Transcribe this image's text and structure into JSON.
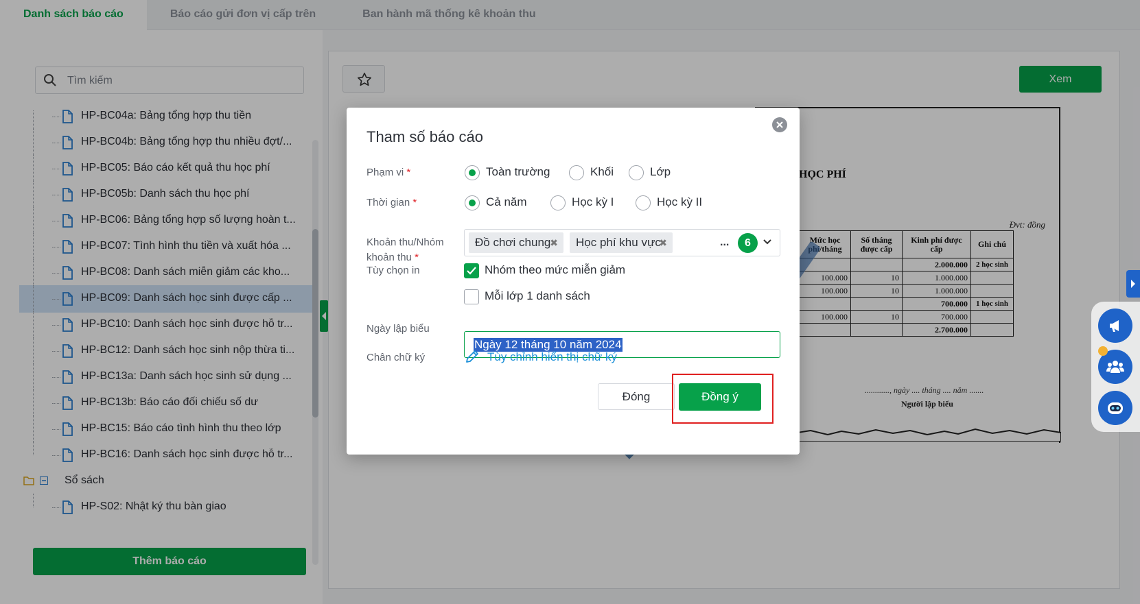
{
  "tabs": [
    {
      "label": "Danh sách báo cáo",
      "active": true
    },
    {
      "label": "Báo cáo gửi đơn vị cấp trên",
      "active": false
    },
    {
      "label": "Ban hành mã thống kê khoản thu",
      "active": false
    }
  ],
  "sidebar": {
    "search_placeholder": "Tìm kiếm",
    "items": [
      "HP-BC04a: Bảng tổng hợp thu tiền",
      "HP-BC04b: Bảng tổng hợp thu nhiều đợt/...",
      "HP-BC05: Báo cáo kết quả thu học phí",
      "HP-BC05b: Danh sách thu học phí",
      "HP-BC06: Bảng tổng hợp số lượng hoàn t...",
      "HP-BC07: Tình hình thu tiền và xuất hóa ...",
      "HP-BC08: Danh sách miễn giảm các kho...",
      "HP-BC09: Danh sách học sinh được cấp ...",
      "HP-BC10: Danh sách học sinh được hỗ tr...",
      "HP-BC12: Danh sách học sinh nộp thừa ti...",
      "HP-BC13a: Danh sách học sinh sử dụng ...",
      "HP-BC13b: Báo cáo đối chiếu số dư",
      "HP-BC15: Báo cáo tình hình thu theo lớp",
      "HP-BC16: Danh sách học sinh được hỗ tr..."
    ],
    "selected_index": 7,
    "folder": "Sổ sách",
    "folder_items": [
      "HP-S02: Nhật ký thu bàn giao"
    ],
    "add_button": "Thêm báo cáo"
  },
  "preview": {
    "view_button": "Xem",
    "report_title_fragment": "HỌC PHÍ",
    "unit": "Đvt: đồng",
    "columns": [
      "Mức học phí/tháng",
      "Số tháng được cấp",
      "Kinh phí được cấp",
      "Ghi chú"
    ],
    "rows": [
      {
        "rate": "",
        "months": "",
        "amount": "2.000.000",
        "note": "2 học sinh",
        "bold": true
      },
      {
        "rate": "100.000",
        "months": "10",
        "amount": "1.000.000",
        "note": "",
        "bold": false
      },
      {
        "rate": "100.000",
        "months": "10",
        "amount": "1.000.000",
        "note": "",
        "bold": false
      },
      {
        "rate": "",
        "months": "",
        "amount": "700.000",
        "note": "1 học sinh",
        "bold": true
      },
      {
        "rate": "100.000",
        "months": "10",
        "amount": "700.000",
        "note": "",
        "bold": false
      },
      {
        "rate": "",
        "months": "",
        "amount": "2.700.000",
        "note": "",
        "bold": true
      }
    ],
    "sign_date": "............, ngày .... tháng .... năm .......",
    "sign_who": "Người lập biểu"
  },
  "modal": {
    "title": "Tham số báo cáo",
    "scope": {
      "label": "Phạm vi",
      "options": [
        "Toàn trường",
        "Khối",
        "Lớp"
      ],
      "selected": 0
    },
    "time": {
      "label": "Thời gian",
      "options": [
        "Cả năm",
        "Học kỳ I",
        "Học kỳ II"
      ],
      "selected": 0
    },
    "fees": {
      "label_line1": "Khoản thu/Nhóm",
      "label_line2": "khoản thu",
      "chips": [
        "Đồ chơi chung",
        "Học phí khu vực"
      ],
      "more": "...",
      "count": "6"
    },
    "print_options": {
      "label": "Tùy chọn in",
      "options": [
        {
          "label": "Nhóm theo mức miễn giảm",
          "checked": true
        },
        {
          "label": "Mỗi lớp 1 danh sách",
          "checked": false
        }
      ]
    },
    "date": {
      "label": "Ngày lập biểu",
      "value": "Ngày 12 tháng 10 năm 2024"
    },
    "signature": {
      "label": "Chân chữ ký",
      "link": "Tùy chỉnh hiển thị chữ ký"
    },
    "close_button": "Đóng",
    "ok_button": "Đồng ý"
  },
  "colors": {
    "primary": "#07a14a",
    "link": "#1a8fd8",
    "highlight": "#e02020",
    "required": "#e0262b"
  }
}
